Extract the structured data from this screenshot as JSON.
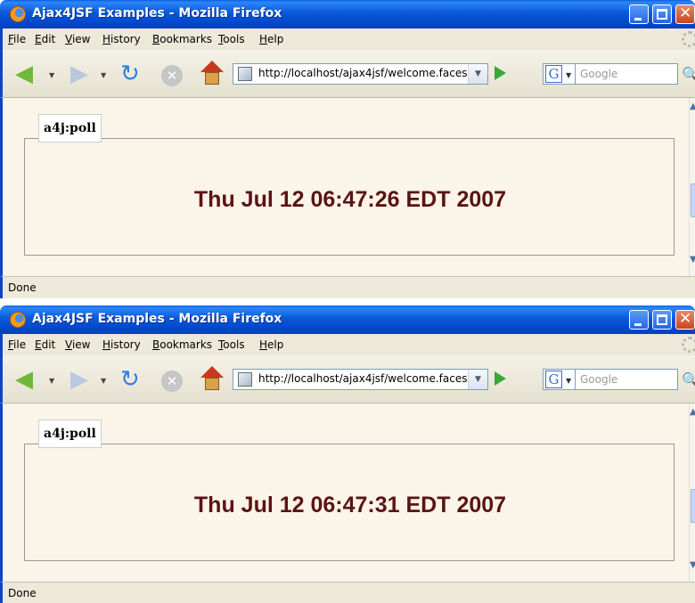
{
  "windows": [
    {
      "title": "Ajax4JSF Examples - Mozilla Firefox",
      "menu": [
        "File",
        "Edit",
        "View",
        "History",
        "Bookmarks",
        "Tools",
        "Help"
      ],
      "url": "http://localhost/ajax4jsf/welcome.faces",
      "search_placeholder": "Google",
      "search_engine_icon": "G",
      "legend": "a4j:poll",
      "time": "Thu Jul 12 06:47:26 EDT 2007",
      "status": "Done"
    },
    {
      "title": "Ajax4JSF Examples - Mozilla Firefox",
      "menu": [
        "File",
        "Edit",
        "View",
        "History",
        "Bookmarks",
        "Tools",
        "Help"
      ],
      "url": "http://localhost/ajax4jsf/welcome.faces",
      "search_placeholder": "Google",
      "search_engine_icon": "G",
      "legend": "a4j:poll",
      "time": "Thu Jul 12 06:47:31 EDT 2007",
      "status": "Done"
    }
  ],
  "colors": {
    "titlebar": "#0859d9",
    "content_bg": "#fbf4e8",
    "time_text": "#5a1414",
    "chrome_bg": "#ece9d8"
  },
  "icons": [
    "firefox-logo-icon",
    "back-arrow-icon",
    "forward-arrow-icon",
    "reload-icon",
    "stop-icon",
    "home-icon",
    "page-icon",
    "go-icon",
    "search-icon",
    "throbber-icon"
  ]
}
